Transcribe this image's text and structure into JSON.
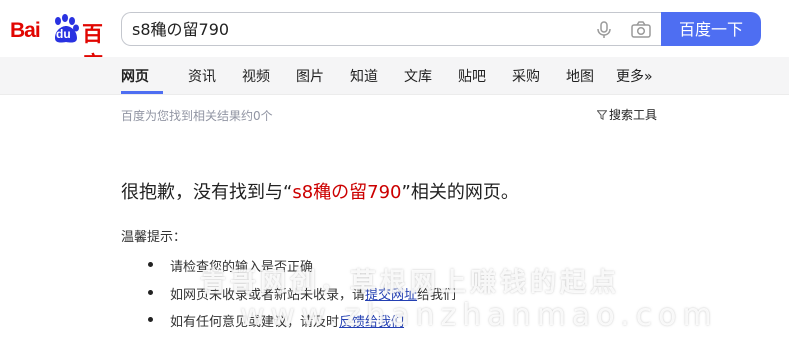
{
  "logo": {
    "latin": "Bai",
    "du": "du",
    "chinese": "百度"
  },
  "search": {
    "query": "s8穐の留790",
    "button_label": "百度一下"
  },
  "tabs": [
    {
      "label": "网页",
      "active": true
    },
    {
      "label": "资讯"
    },
    {
      "label": "视频"
    },
    {
      "label": "图片"
    },
    {
      "label": "知道"
    },
    {
      "label": "文库"
    },
    {
      "label": "贴吧"
    },
    {
      "label": "采购"
    },
    {
      "label": "地图"
    },
    {
      "label": "更多»"
    }
  ],
  "result_info": {
    "count_text": "百度为您找到相关结果约0个",
    "tools_label": "搜索工具"
  },
  "no_result": {
    "prefix": "很抱歉，没有找到与“",
    "query": "s8穐の留790",
    "suffix": "”相关的网页。"
  },
  "tips": {
    "title": "温馨提示：",
    "items": [
      {
        "text": "请检查您的输入是否正确"
      },
      {
        "text": "如网页未收录或者新站未收录，请",
        "link": "提交网址",
        "after": "给我们"
      },
      {
        "text": "如有任何意见或建议，请及时",
        "link": "反馈给我们"
      }
    ]
  },
  "watermark": {
    "line1": "青哥网创，草根网上赚钱的起点",
    "line2": "www.zhanzhanmao.com"
  },
  "colors": {
    "brand_red": "#e10601",
    "brand_blue": "#4e6ef2",
    "query_red": "#cc0000",
    "link_blue": "#2440b3"
  }
}
